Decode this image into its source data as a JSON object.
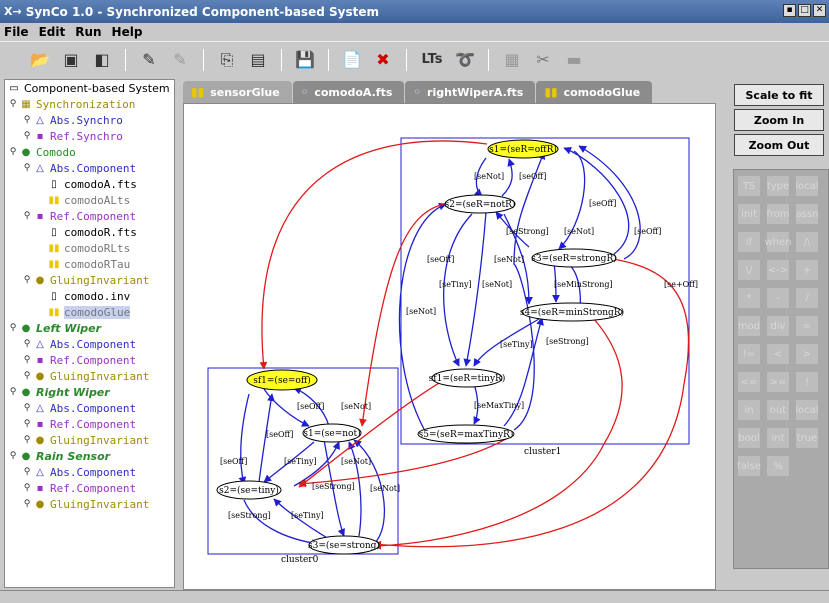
{
  "window": {
    "title": "SynCo 1.0 - Synchronized Component-based System",
    "logo": "X→"
  },
  "menu": {
    "items": [
      "File",
      "Edit",
      "Run",
      "Help"
    ]
  },
  "toolbar": {
    "icons": [
      "open-folder-icon",
      "window-icon",
      "copy-window-icon",
      "edit-icon",
      "edit-disabled-icon",
      "copy-icon",
      "paste-icon",
      "save-icon",
      "new-page-icon",
      "close-doc-icon",
      "lts-icon",
      "run-icon",
      "doc-disabled-icon",
      "cut-icon",
      "chat-icon"
    ],
    "lts_label": "LTs"
  },
  "tree": {
    "root": "Component-based System",
    "rows": [
      {
        "label": "Synchronization",
        "color": "#a08a00",
        "indent": 0
      },
      {
        "label": "Abs.Synchro",
        "color": "#2f2fc8",
        "indent": 1
      },
      {
        "label": "Ref.Synchro",
        "color": "#9b30c8",
        "indent": 1
      },
      {
        "label": "Comodo",
        "color": "#2b8a2b",
        "indent": 0
      },
      {
        "label": "Abs.Component",
        "color": "#2f2fc8",
        "indent": 1
      },
      {
        "label": "comodoA.fts",
        "color": "#000000",
        "indent": 2
      },
      {
        "label": "comodoALts",
        "color": "#777777",
        "indent": 2
      },
      {
        "label": "Ref.Component",
        "color": "#9b30c8",
        "indent": 1
      },
      {
        "label": "comodoR.fts",
        "color": "#000000",
        "indent": 2
      },
      {
        "label": "comodoRLts",
        "color": "#777777",
        "indent": 2
      },
      {
        "label": "comodoRTau",
        "color": "#777777",
        "indent": 2
      },
      {
        "label": "GluingInvariant",
        "color": "#a08a00",
        "indent": 1
      },
      {
        "label": "comodo.inv",
        "color": "#000000",
        "indent": 2
      },
      {
        "label": "comodoGlue",
        "color": "#777777",
        "indent": 2
      },
      {
        "label": "Left Wiper",
        "color": "#2b8a2b",
        "indent": 0
      },
      {
        "label": "Abs.Component",
        "color": "#2f2fc8",
        "indent": 1
      },
      {
        "label": "Ref.Component",
        "color": "#9b30c8",
        "indent": 1
      },
      {
        "label": "GluingInvariant",
        "color": "#a08a00",
        "indent": 1
      },
      {
        "label": "Right Wiper",
        "color": "#2b8a2b",
        "indent": 0
      },
      {
        "label": "Abs.Component",
        "color": "#2f2fc8",
        "indent": 1
      },
      {
        "label": "Ref.Component",
        "color": "#9b30c8",
        "indent": 1
      },
      {
        "label": "GluingInvariant",
        "color": "#a08a00",
        "indent": 1
      },
      {
        "label": "Rain Sensor",
        "color": "#2b8a2b",
        "indent": 0
      },
      {
        "label": "Abs.Component",
        "color": "#2f2fc8",
        "indent": 1
      },
      {
        "label": "Ref.Component",
        "color": "#9b30c8",
        "indent": 1
      },
      {
        "label": "GluingInvariant",
        "color": "#a08a00",
        "indent": 1
      }
    ]
  },
  "tabs": [
    {
      "label": "sensorGlue",
      "active": true
    },
    {
      "label": "comodoA.fts",
      "active": false
    },
    {
      "label": "rightWiperA.fts",
      "active": false
    },
    {
      "label": "comodoGlue",
      "active": false
    }
  ],
  "zoom": {
    "scale_to_fit": "Scale to fit",
    "zoom_in": "Zoom In",
    "zoom_out": "Zoom Out"
  },
  "palette": [
    "TS",
    "type",
    "local",
    "init",
    "from",
    "assn",
    "if",
    "when",
    "/\\",
    "\\/",
    "<->",
    "+",
    "*",
    "-",
    "/",
    "mod",
    "div",
    "=",
    "!=",
    "<",
    ">",
    "<=",
    ">=",
    "!",
    "in",
    "out",
    "local",
    "bool",
    "int",
    "true",
    "false",
    "%"
  ],
  "graph": {
    "clusters": [
      "cluster0",
      "cluster1"
    ],
    "nodes": {
      "s1R": "s1=(seR=offR)",
      "s2R": "s2=(seR=notR)",
      "s3R": "s3=(seR=strongR)",
      "s4R": "s4=(seR=minStrongR)",
      "sf1R": "sf1=(seR=tinyR)",
      "s5R": "s5=(seR=maxTinyR)",
      "sf1": "sf1=(se=off)",
      "s1": "s1=(se=not)",
      "s2": "s2=(se=tiny)",
      "s3": "s3=(se=strong)"
    },
    "edge_labels": {
      "seNot": "[seNot]",
      "seOff": "[seOff]",
      "seStrong": "[seStrong]",
      "seTiny": "[seTiny]",
      "seMinStrong": "[seMinStrong]",
      "seMaxTiny": "[seMaxTiny]",
      "seoff": "[se+Off]"
    }
  },
  "colors": {
    "blue_edge": "#1f1fd0",
    "red_edge": "#e01b1b",
    "highlight": "#ffff22"
  }
}
